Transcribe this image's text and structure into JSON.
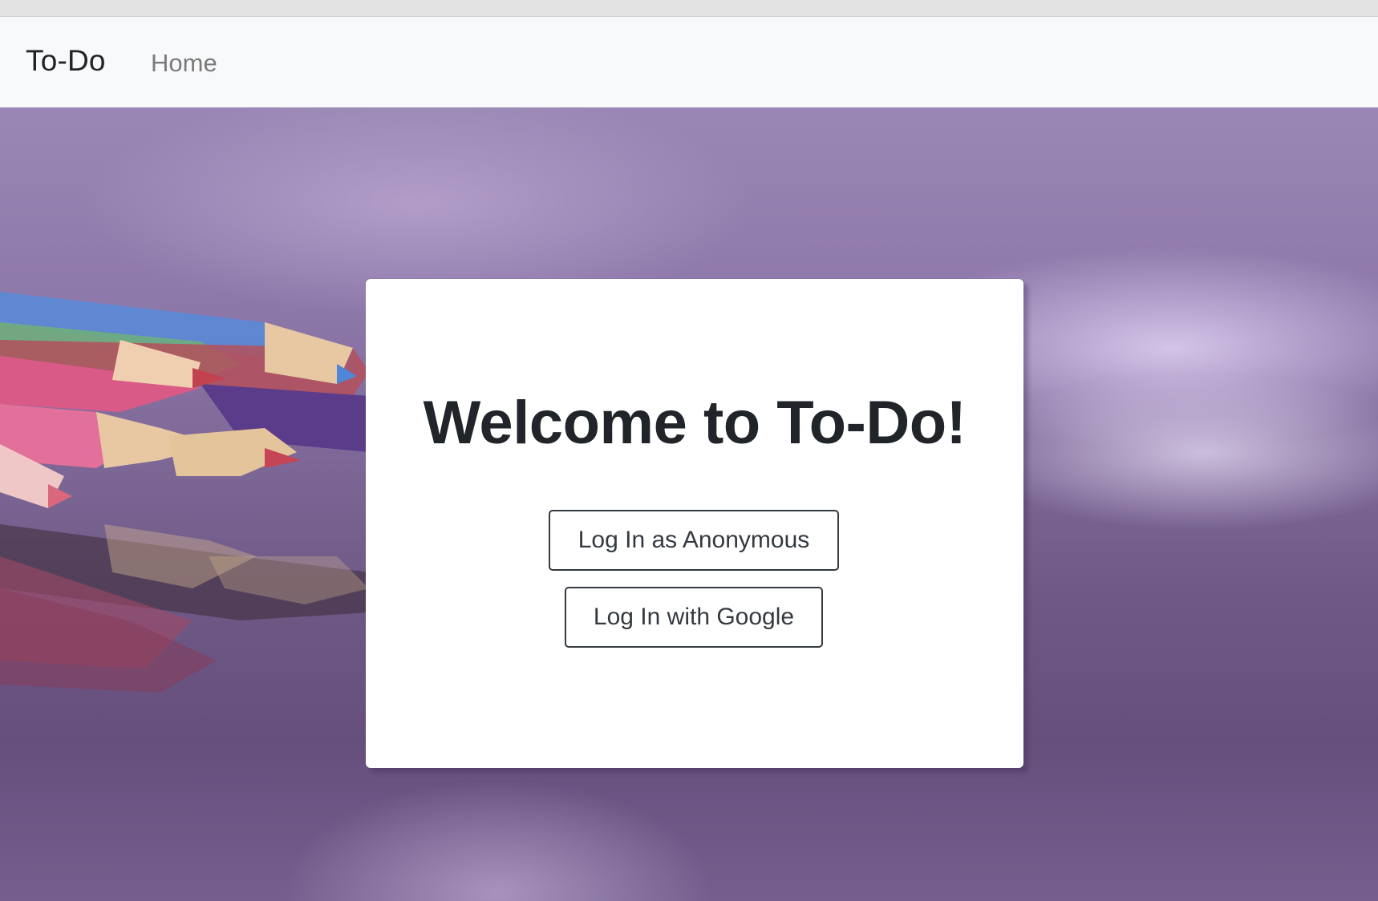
{
  "navbar": {
    "brand": "To-Do",
    "links": [
      {
        "label": "Home"
      }
    ]
  },
  "card": {
    "title": "Welcome to To-Do!",
    "buttons": {
      "anonymous": "Log In as Anonymous",
      "google": "Log In with Google"
    }
  },
  "colors": {
    "navbar_bg": "#f8f9fa",
    "text_dark": "#212529",
    "nav_link": "#7a7a7a",
    "button_border": "#343a40",
    "background_purple": "#7d6796"
  },
  "background_image": "colored-pencils-on-purple"
}
